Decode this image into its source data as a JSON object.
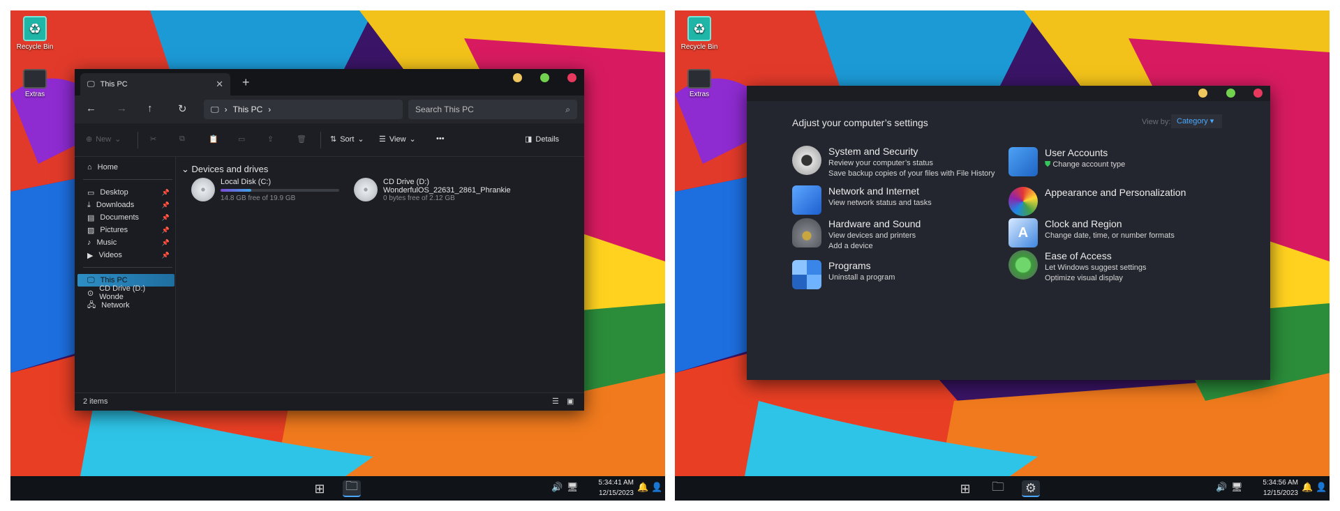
{
  "desktop": {
    "recycle_bin_label": "Recycle Bin",
    "extras_label": "Extras"
  },
  "explorer": {
    "tab_title": "This PC",
    "breadcrumb": "This PC",
    "search_placeholder": "Search This PC",
    "commands": {
      "new": "New",
      "sort": "Sort",
      "view": "View",
      "more": "•••",
      "details": "Details"
    },
    "sidebar": {
      "home": "Home",
      "quick_access": [
        "Desktop",
        "Downloads",
        "Documents",
        "Pictures",
        "Music",
        "Videos"
      ],
      "this_pc": "This PC",
      "cd_drive": "CD Drive (D:) Wonde",
      "network": "Network"
    },
    "group_heading": "Devices and drives",
    "drives": [
      {
        "name": "Local Disk (C:)",
        "free": "14.8 GB free of 19.9 GB",
        "used_fraction": 0.26
      },
      {
        "name": "CD Drive (D:)",
        "label": "WonderfulOS_22631_2861_Phrankie",
        "free": "0 bytes free of 2.12 GB"
      }
    ],
    "status": "2 items"
  },
  "control_panel": {
    "title": "Adjust your computer’s settings",
    "view_by_label": "View by:",
    "view_by_value": "Category",
    "categories": [
      {
        "title": "System and Security",
        "links": [
          "Review your computer’s status",
          "Save backup copies of your files with File History"
        ]
      },
      {
        "title": "Network and Internet",
        "links": [
          "View network status and tasks"
        ]
      },
      {
        "title": "Hardware and Sound",
        "links": [
          "View devices and printers",
          "Add a device"
        ]
      },
      {
        "title": "Programs",
        "links": [
          "Uninstall a program"
        ]
      },
      {
        "title": "User Accounts",
        "links": [
          "Change account type"
        ]
      },
      {
        "title": "Appearance and Personalization",
        "links": []
      },
      {
        "title": "Clock and Region",
        "links": [
          "Change date, time, or number formats"
        ]
      },
      {
        "title": "Ease of Access",
        "links": [
          "Let Windows suggest settings",
          "Optimize visual display"
        ]
      }
    ]
  },
  "taskbar_left": {
    "time": "5:34:41 AM",
    "date": "12/15/2023"
  },
  "taskbar_right": {
    "time": "5:34:56 AM",
    "date": "12/15/2023"
  },
  "colors": {
    "accent": "#4aa8ff",
    "window_bg": "#1e2026",
    "taskbar": "#101318",
    "close": "#e8385e",
    "minimize": "#f0c75e",
    "maximize": "#72d24f"
  }
}
